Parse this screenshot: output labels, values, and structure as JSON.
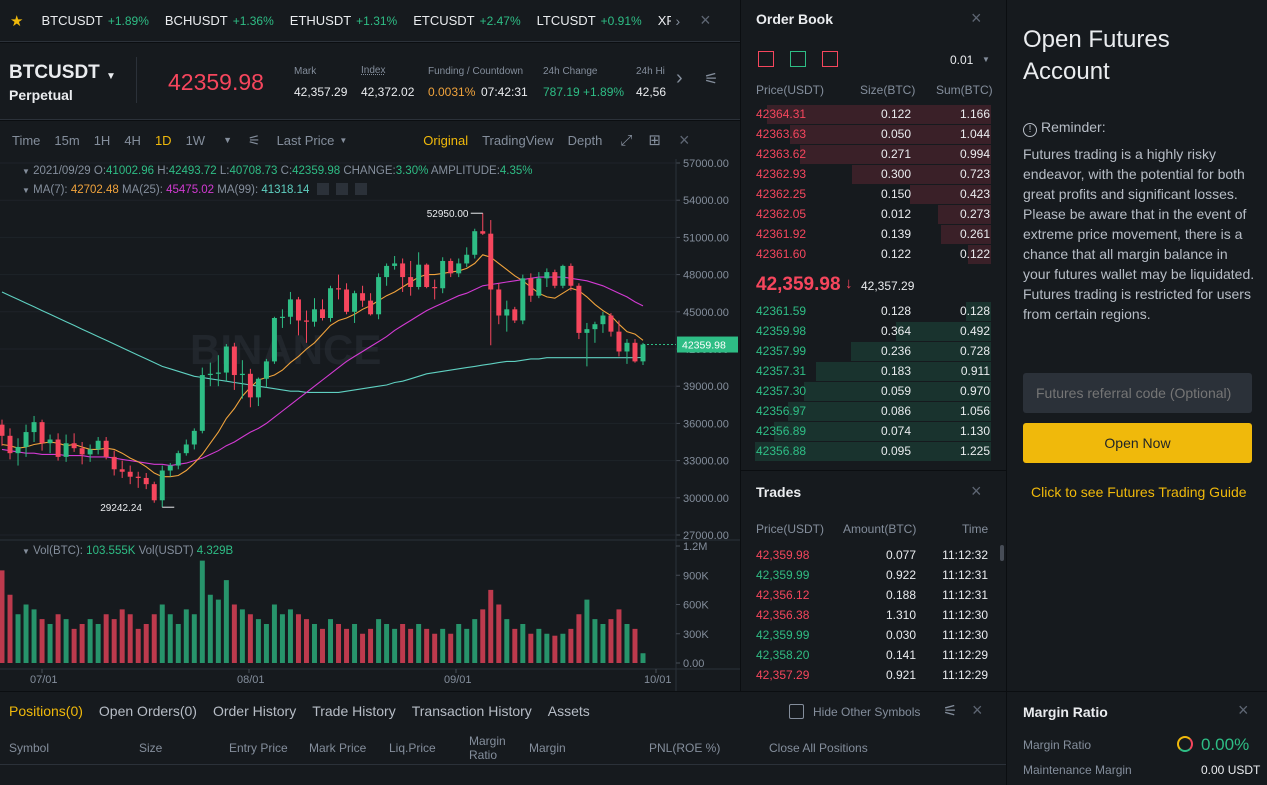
{
  "ticker": [
    {
      "sym": "BTCUSDT",
      "pct": "+1.89%"
    },
    {
      "sym": "BCHUSDT",
      "pct": "+1.36%"
    },
    {
      "sym": "ETHUSDT",
      "pct": "+1.31%"
    },
    {
      "sym": "ETCUSDT",
      "pct": "+2.47%"
    },
    {
      "sym": "LTCUSDT",
      "pct": "+0.91%"
    },
    {
      "sym": "XRPU",
      "pct": ""
    }
  ],
  "header": {
    "symbol": "BTCUSDT",
    "type": "Perpetual",
    "price": "42359.98",
    "mark_label": "Mark",
    "mark": "42,357.29",
    "index_label": "Index",
    "index": "42,372.02",
    "funding_label": "Funding / Countdown",
    "funding": "0.0031%",
    "countdown": "07:42:31",
    "change_label": "24h Change",
    "change": "787.19 +1.89%",
    "high_label": "24h Hi",
    "high": "42,56"
  },
  "toolbar": {
    "intervals": [
      "Time",
      "15m",
      "1H",
      "4H",
      "1D",
      "1W"
    ],
    "active_interval": "1D",
    "price_type": "Last Price",
    "views": [
      "Original",
      "TradingView",
      "Depth"
    ],
    "active_view": "Original"
  },
  "chart": {
    "ohlc": {
      "date": "2021/09/29",
      "o_label": "O:",
      "o": "41002.96",
      "h_label": "H:",
      "h": "42493.72",
      "l_label": "L:",
      "l": "40708.73",
      "c_label": "C:",
      "c": "42359.98",
      "change_label": "CHANGE:",
      "change": "3.30%",
      "amp_label": "AMPLITUDE:",
      "amp": "4.35%"
    },
    "ma": {
      "ma7_label": "MA(7):",
      "ma7": "42702.48",
      "ma25_label": "MA(25):",
      "ma25": "45475.02",
      "ma99_label": "MA(99):",
      "ma99": "41318.14"
    },
    "yticks": [
      "57000.00",
      "54000.00",
      "51000.00",
      "48000.00",
      "45000.00",
      "42000.00",
      "39000.00",
      "36000.00",
      "33000.00",
      "30000.00",
      "27000.00"
    ],
    "high_label": "52950.00",
    "low_label": "29242.24",
    "last_label": "42359.98",
    "watermark": "BINANCE",
    "vol": {
      "vol_btc_label": "Vol(BTC):",
      "vol_btc": "103.555K",
      "vol_usdt_label": "Vol(USDT)",
      "vol_usdt": "4.329B"
    },
    "vticks": [
      "1.2M",
      "900K",
      "600K",
      "300K",
      "0.00"
    ],
    "xticks": [
      "07/01",
      "08/01",
      "09/01",
      "10/01"
    ]
  },
  "chart_data": {
    "type": "candlestick",
    "ylim": [
      27000,
      57000
    ],
    "candles": [
      [
        35900,
        36300,
        34200,
        35000
      ],
      [
        35000,
        35600,
        33100,
        33600
      ],
      [
        33600,
        34800,
        32600,
        34100
      ],
      [
        34100,
        35900,
        33300,
        35300
      ],
      [
        35300,
        36600,
        34500,
        36100
      ],
      [
        36100,
        36300,
        33800,
        34400
      ],
      [
        34400,
        35100,
        33600,
        34700
      ],
      [
        34700,
        35200,
        33000,
        33300
      ],
      [
        33300,
        35100,
        32900,
        34400
      ],
      [
        34400,
        35200,
        33700,
        34000
      ],
      [
        34000,
        34500,
        32700,
        33500
      ],
      [
        33500,
        34300,
        32900,
        33900
      ],
      [
        33900,
        34900,
        33500,
        34600
      ],
      [
        34600,
        34900,
        33100,
        33300
      ],
      [
        33300,
        33800,
        31800,
        32300
      ],
      [
        32300,
        33000,
        31600,
        32100
      ],
      [
        32100,
        32600,
        31100,
        31700
      ],
      [
        31700,
        32100,
        30800,
        31600
      ],
      [
        31600,
        32000,
        30700,
        31100
      ],
      [
        31100,
        31300,
        29600,
        29800
      ],
      [
        29800,
        32600,
        29242,
        32200
      ],
      [
        32200,
        32800,
        31700,
        32600
      ],
      [
        32600,
        33800,
        32300,
        33600
      ],
      [
        33600,
        34700,
        33400,
        34300
      ],
      [
        34300,
        35600,
        33900,
        35400
      ],
      [
        35400,
        40500,
        35200,
        39900
      ],
      [
        39900,
        40900,
        39000,
        40000
      ],
      [
        40000,
        41500,
        39000,
        40100
      ],
      [
        40100,
        42400,
        39400,
        42200
      ],
      [
        42200,
        42500,
        38700,
        39900
      ],
      [
        39900,
        41100,
        38000,
        40000
      ],
      [
        40000,
        40400,
        37300,
        38100
      ],
      [
        38100,
        39700,
        37400,
        39600
      ],
      [
        39600,
        41200,
        38900,
        41000
      ],
      [
        41000,
        44600,
        40800,
        44500
      ],
      [
        44500,
        45200,
        43700,
        44600
      ],
      [
        44600,
        46600,
        44000,
        46000
      ],
      [
        46000,
        46200,
        43100,
        44300
      ],
      [
        44300,
        45100,
        42500,
        44200
      ],
      [
        44200,
        46100,
        43800,
        45200
      ],
      [
        45200,
        46000,
        44300,
        44500
      ],
      [
        44500,
        47100,
        44200,
        46900
      ],
      [
        46900,
        48000,
        46000,
        46800
      ],
      [
        46800,
        47300,
        44800,
        45000
      ],
      [
        45000,
        46700,
        44100,
        46500
      ],
      [
        46500,
        47100,
        45400,
        45900
      ],
      [
        45900,
        46500,
        44700,
        44800
      ],
      [
        44800,
        48100,
        44400,
        47800
      ],
      [
        47800,
        48900,
        47100,
        48700
      ],
      [
        48700,
        49500,
        48400,
        48900
      ],
      [
        48900,
        49300,
        46600,
        47800
      ],
      [
        47800,
        49100,
        46300,
        47000
      ],
      [
        47000,
        49800,
        46800,
        48800
      ],
      [
        48800,
        48900,
        46900,
        47000
      ],
      [
        47000,
        47600,
        46000,
        46900
      ],
      [
        46900,
        49400,
        46500,
        49100
      ],
      [
        49100,
        49300,
        47800,
        48100
      ],
      [
        48100,
        49300,
        47800,
        48900
      ],
      [
        48900,
        50200,
        48600,
        49600
      ],
      [
        49600,
        51700,
        49300,
        51500
      ],
      [
        51500,
        52950,
        51200,
        51300
      ],
      [
        51300,
        52400,
        42300,
        46800
      ],
      [
        46800,
        47300,
        44000,
        44700
      ],
      [
        44700,
        45900,
        43400,
        45200
      ],
      [
        45200,
        45400,
        44100,
        44300
      ],
      [
        44300,
        48000,
        44000,
        47700
      ],
      [
        47700,
        48100,
        45800,
        46300
      ],
      [
        46300,
        48200,
        46100,
        47700
      ],
      [
        47700,
        48500,
        47000,
        48200
      ],
      [
        48200,
        48400,
        46900,
        47100
      ],
      [
        47100,
        48800,
        46900,
        48700
      ],
      [
        48700,
        48900,
        46700,
        47100
      ],
      [
        47100,
        47300,
        42800,
        43300
      ],
      [
        43300,
        44100,
        40600,
        43600
      ],
      [
        43600,
        44200,
        42500,
        44000
      ],
      [
        44000,
        45000,
        43300,
        44700
      ],
      [
        44700,
        44900,
        43000,
        43400
      ],
      [
        43400,
        44300,
        41400,
        41800
      ],
      [
        41800,
        42800,
        40800,
        42500
      ],
      [
        42500,
        42800,
        40900,
        41000
      ],
      [
        41002.96,
        42493.72,
        40708.73,
        42359.98
      ]
    ],
    "ma7": [
      34300,
      34200,
      34000,
      34100,
      34300,
      34400,
      34500,
      34400,
      34200,
      34300,
      34100,
      33900,
      33900,
      34000,
      33900,
      33600,
      33200,
      32900,
      32500,
      32000,
      31700,
      31700,
      31800,
      32200,
      32800,
      33500,
      34400,
      35300,
      36400,
      37200,
      38200,
      38900,
      39500,
      39700,
      39900,
      40300,
      40900,
      41400,
      42000,
      42500,
      43200,
      43900,
      44300,
      44500,
      44800,
      45200,
      45500,
      45900,
      46300,
      46600,
      47000,
      47400,
      47800,
      48000,
      48000,
      48100,
      48200,
      48300,
      48500,
      48900,
      49600,
      49400,
      48900,
      48400,
      47900,
      47500,
      47000,
      46500,
      46200,
      46100,
      46500,
      46900,
      46700,
      46200,
      45600,
      45100,
      44700,
      44000,
      43400,
      43200,
      42702
    ],
    "ma25": [
      33900,
      33800,
      33700,
      33600,
      33600,
      33500,
      33500,
      33500,
      33400,
      33400,
      33400,
      33300,
      33300,
      33300,
      33200,
      33100,
      33000,
      32900,
      32800,
      32700,
      32700,
      32600,
      32700,
      32800,
      33000,
      33200,
      33500,
      33800,
      34200,
      34500,
      34900,
      35300,
      35600,
      36000,
      36500,
      37000,
      37500,
      38000,
      38500,
      39000,
      39500,
      40000,
      40500,
      41000,
      41400,
      41800,
      42200,
      42600,
      43000,
      43500,
      43900,
      44300,
      44700,
      45100,
      45400,
      45700,
      46000,
      46300,
      46500,
      46800,
      47100,
      47200,
      47300,
      47400,
      47500,
      47600,
      47700,
      47800,
      47800,
      47800,
      47800,
      47700,
      47600,
      47500,
      47300,
      47100,
      46800,
      46500,
      46200,
      45800,
      45475
    ],
    "ma99": [
      46600,
      46300,
      46000,
      45700,
      45400,
      45100,
      44800,
      44500,
      44200,
      43900,
      43600,
      43300,
      43000,
      42700,
      42400,
      42100,
      41800,
      41500,
      41200,
      40900,
      40600,
      40400,
      40200,
      40000,
      39800,
      39700,
      39600,
      39500,
      39400,
      39300,
      39200,
      39100,
      39000,
      38900,
      38800,
      38700,
      38600,
      38600,
      38500,
      38500,
      38500,
      38500,
      38500,
      38600,
      38700,
      38800,
      38900,
      39000,
      39100,
      39300,
      39400,
      39600,
      39800,
      40000,
      40100,
      40200,
      40300,
      40400,
      40500,
      40600,
      40700,
      40800,
      40900,
      41000,
      41000,
      41100,
      41200,
      41200,
      41300,
      41300,
      41300,
      41300,
      41300,
      41300,
      41300,
      41300,
      41300,
      41300,
      41300,
      41300,
      41318
    ],
    "volumes": [
      0.95,
      0.7,
      0.5,
      0.6,
      0.55,
      0.45,
      0.4,
      0.5,
      0.45,
      0.35,
      0.4,
      0.45,
      0.4,
      0.5,
      0.45,
      0.55,
      0.5,
      0.35,
      0.4,
      0.5,
      0.6,
      0.5,
      0.4,
      0.55,
      0.5,
      1.05,
      0.7,
      0.65,
      0.85,
      0.6,
      0.55,
      0.5,
      0.45,
      0.4,
      0.6,
      0.5,
      0.55,
      0.5,
      0.45,
      0.4,
      0.35,
      0.45,
      0.4,
      0.35,
      0.4,
      0.3,
      0.35,
      0.45,
      0.4,
      0.35,
      0.4,
      0.35,
      0.4,
      0.35,
      0.3,
      0.35,
      0.3,
      0.4,
      0.35,
      0.45,
      0.55,
      0.75,
      0.6,
      0.45,
      0.35,
      0.4,
      0.3,
      0.35,
      0.3,
      0.28,
      0.3,
      0.35,
      0.5,
      0.65,
      0.45,
      0.4,
      0.45,
      0.55,
      0.4,
      0.35,
      0.1
    ]
  },
  "orderbook": {
    "title": "Order Book",
    "tick": "0.01",
    "cols": [
      "Price(USDT)",
      "Size(BTC)",
      "Sum(BTC)"
    ],
    "asks": [
      [
        "42364.31",
        "0.122",
        "1.166"
      ],
      [
        "42363.63",
        "0.050",
        "1.044"
      ],
      [
        "42363.62",
        "0.271",
        "0.994"
      ],
      [
        "42362.93",
        "0.300",
        "0.723"
      ],
      [
        "42362.25",
        "0.150",
        "0.423"
      ],
      [
        "42362.05",
        "0.012",
        "0.273"
      ],
      [
        "42361.92",
        "0.139",
        "0.261"
      ],
      [
        "42361.60",
        "0.122",
        "0.122"
      ]
    ],
    "mid": "42,359.98",
    "mid_arrow": "↓",
    "mid_mark": "42,357.29",
    "bids": [
      [
        "42361.59",
        "0.128",
        "0.128"
      ],
      [
        "42359.98",
        "0.364",
        "0.492"
      ],
      [
        "42357.99",
        "0.236",
        "0.728"
      ],
      [
        "42357.31",
        "0.183",
        "0.911"
      ],
      [
        "42357.30",
        "0.059",
        "0.970"
      ],
      [
        "42356.97",
        "0.086",
        "1.056"
      ],
      [
        "42356.89",
        "0.074",
        "1.130"
      ],
      [
        "42356.88",
        "0.095",
        "1.225"
      ]
    ]
  },
  "trades": {
    "title": "Trades",
    "cols": [
      "Price(USDT)",
      "Amount(BTC)",
      "Time"
    ],
    "rows": [
      [
        "42,359.98",
        "0.077",
        "11:12:32",
        "r"
      ],
      [
        "42,359.99",
        "0.922",
        "11:12:31",
        "g"
      ],
      [
        "42,356.12",
        "0.188",
        "11:12:31",
        "r"
      ],
      [
        "42,356.38",
        "1.310",
        "11:12:30",
        "r"
      ],
      [
        "42,359.99",
        "0.030",
        "11:12:30",
        "g"
      ],
      [
        "42,358.20",
        "0.141",
        "11:12:29",
        "g"
      ],
      [
        "42,357.29",
        "0.921",
        "11:12:29",
        "r"
      ]
    ]
  },
  "account": {
    "title": "Open Futures Account",
    "reminder_title": "Reminder:",
    "reminder_text": "Futures trading is a highly risky endeavor, with the potential for both great profits and significant losses. Please be aware that in the event of extreme price movement, there is a chance that all margin balance in your futures wallet may be liquidated. Futures trading is restricted for users from certain regions.",
    "referral_placeholder": "Futures referral code (Optional)",
    "open_btn": "Open Now",
    "guide": "Click to see Futures Trading Guide"
  },
  "bottom": {
    "tabs": [
      "Positions(0)",
      "Open Orders(0)",
      "Order History",
      "Trade History",
      "Transaction History",
      "Assets"
    ],
    "hide_other": "Hide Other Symbols",
    "cols": [
      "Symbol",
      "Size",
      "Entry Price",
      "Mark Price",
      "Liq.Price",
      "Margin\nRatio",
      "Margin",
      "PNL(ROE %)",
      "Close All Positions"
    ]
  },
  "margin": {
    "title": "Margin Ratio",
    "ratio_label": "Margin Ratio",
    "ratio": "0.00%",
    "maint_label": "Maintenance Margin",
    "maint": "0.00 USDT"
  },
  "colors": {
    "up": "#2ebd85",
    "down": "#f6465d",
    "accent": "#f0b90b",
    "ma7": "#f0a33c",
    "ma25": "#d23ad2",
    "ma99": "#5fd0c1"
  }
}
